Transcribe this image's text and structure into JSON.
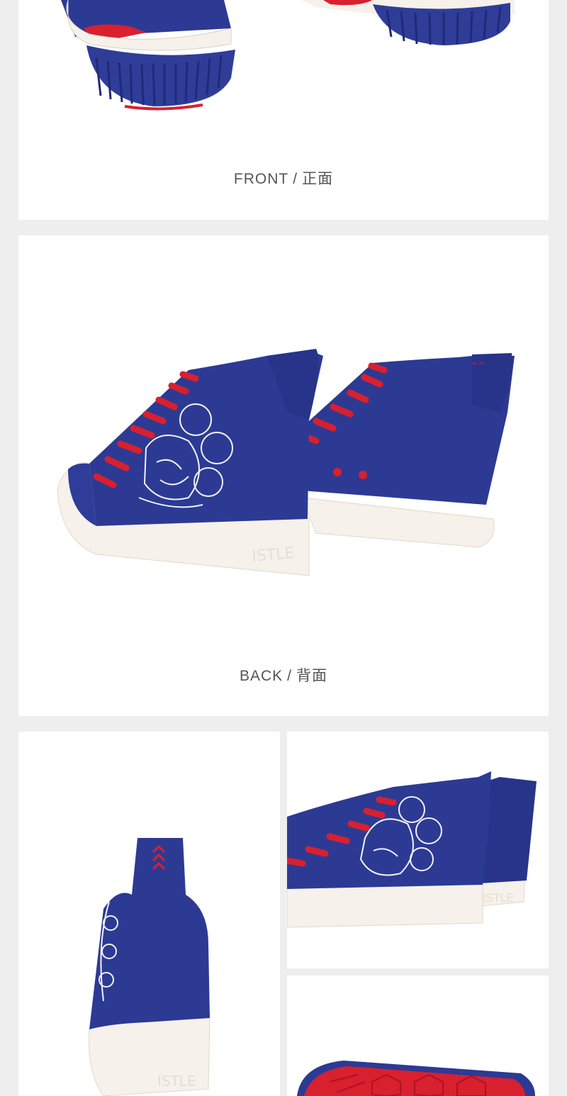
{
  "colors": {
    "canvas": "#eeeeee",
    "panel": "#ffffff",
    "canvas_blue": "#2c3a94",
    "lace_red": "#d8202f",
    "sole_white": "#f6f1ea",
    "caption_gray": "#555555"
  },
  "sections": {
    "front": {
      "label_en": "FRONT",
      "separator": "/",
      "label_cn": "正面"
    },
    "back": {
      "label_en": "BACK",
      "separator": "/",
      "label_cn": "背面"
    }
  },
  "logo_text": "ISTLE"
}
